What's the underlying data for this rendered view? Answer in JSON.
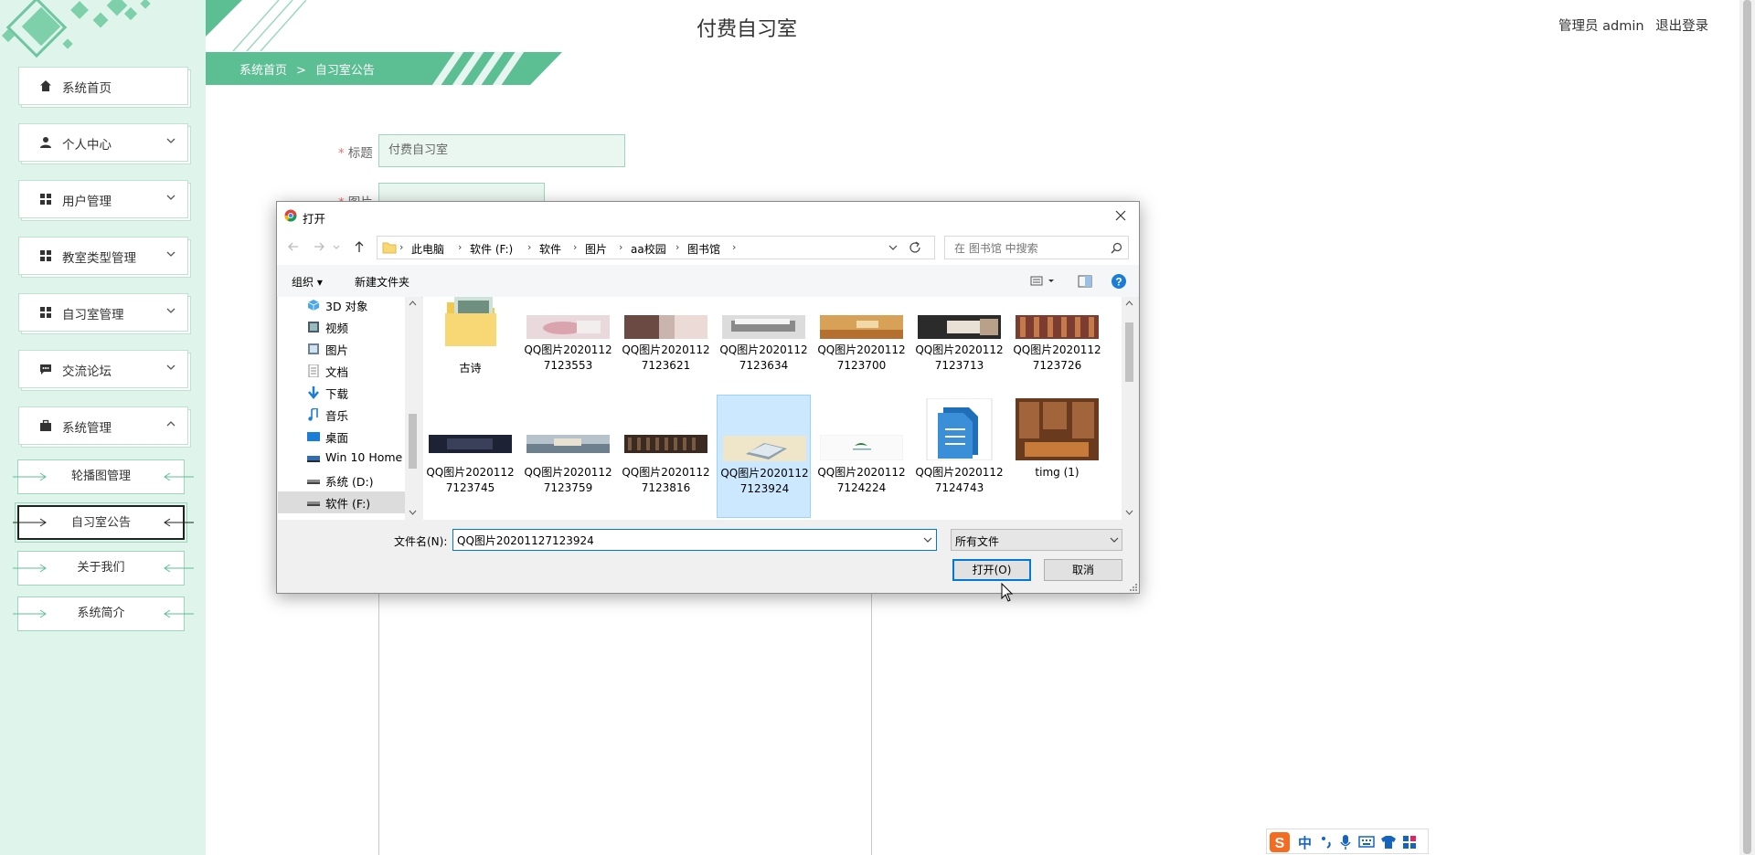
{
  "header": {
    "title": "付费自习室",
    "user_role": "管理员 admin",
    "logout": "退出登录"
  },
  "breadcrumb": {
    "home": "系统首页",
    "separator": ">",
    "current": "自习室公告"
  },
  "sidebar": {
    "items": [
      {
        "label": "系统首页",
        "icon": "home-icon"
      },
      {
        "label": "个人中心",
        "icon": "user-icon"
      },
      {
        "label": "用户管理",
        "icon": "grid-icon"
      },
      {
        "label": "教室类型管理",
        "icon": "grid-icon"
      },
      {
        "label": "自习室管理",
        "icon": "grid-icon"
      },
      {
        "label": "交流论坛",
        "icon": "chat-icon"
      },
      {
        "label": "系统管理",
        "icon": "briefcase-icon"
      }
    ],
    "sub_items": [
      {
        "label": "轮播图管理"
      },
      {
        "label": "自习室公告"
      },
      {
        "label": "关于我们"
      },
      {
        "label": "系统简介"
      }
    ]
  },
  "form": {
    "title_label": "标题",
    "title_value": "付费自习室",
    "image_label": "图片"
  },
  "dialog": {
    "title": "打开",
    "path": [
      "此电脑",
      "软件 (F:)",
      "软件",
      "图片",
      "aa校园",
      "图书馆"
    ],
    "search_placeholder": "在 图书馆 中搜索",
    "toolbar": {
      "organize": "组织 ▾",
      "new_folder": "新建文件夹"
    },
    "tree": [
      {
        "label": "3D 对象",
        "icon": "cube-icon"
      },
      {
        "label": "视频",
        "icon": "video-icon"
      },
      {
        "label": "图片",
        "icon": "picture-icon"
      },
      {
        "label": "文档",
        "icon": "document-icon"
      },
      {
        "label": "下载",
        "icon": "download-icon"
      },
      {
        "label": "音乐",
        "icon": "music-icon"
      },
      {
        "label": "桌面",
        "icon": "desktop-icon"
      },
      {
        "label": "Win 10 Home ›",
        "icon": "drive-icon"
      },
      {
        "label": "系统 (D:)",
        "icon": "drive-icon"
      },
      {
        "label": "软件 (F:)",
        "icon": "drive-icon"
      }
    ],
    "files_row1": [
      {
        "name": "古诗",
        "kind": "folder"
      },
      {
        "name": "QQ图片20201127123553",
        "kind": "image"
      },
      {
        "name": "QQ图片20201127123621",
        "kind": "image"
      },
      {
        "name": "QQ图片20201127123634",
        "kind": "image"
      },
      {
        "name": "QQ图片20201127123700",
        "kind": "image"
      },
      {
        "name": "QQ图片20201127123713",
        "kind": "image"
      },
      {
        "name": "QQ图片20201127123726",
        "kind": "image"
      }
    ],
    "files_row2": [
      {
        "name": "QQ图片20201127123745",
        "kind": "image"
      },
      {
        "name": "QQ图片20201127123759",
        "kind": "image"
      },
      {
        "name": "QQ图片20201127123816",
        "kind": "image"
      },
      {
        "name": "QQ图片20201127123924",
        "kind": "image",
        "selected": true
      },
      {
        "name": "QQ图片20201127124224",
        "kind": "image"
      },
      {
        "name": "QQ图片20201127124743",
        "kind": "image"
      },
      {
        "name": "timg (1)",
        "kind": "image"
      }
    ],
    "filename_label": "文件名(N):",
    "filename_value": "QQ图片20201127123924",
    "filetype": "所有文件",
    "open_button": "打开(O)",
    "cancel_button": "取消"
  },
  "ime": {
    "label": "中"
  },
  "colors": {
    "sidebar_bg": "#dff4ea",
    "accent": "#5cbf94",
    "selection": "#cce8ff",
    "primary_blue": "#0078d7"
  }
}
